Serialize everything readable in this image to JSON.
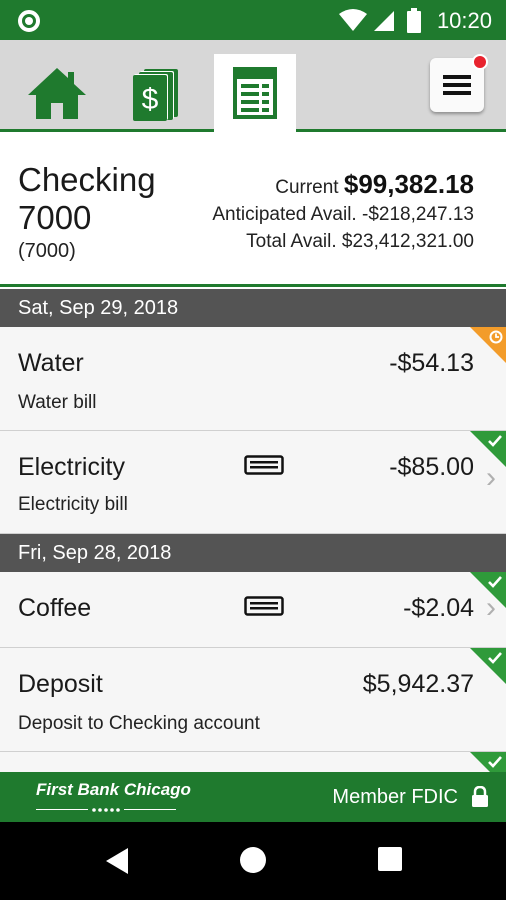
{
  "status_bar": {
    "time": "10:20",
    "icons": [
      "circle-icon",
      "wifi-icon",
      "signal-icon",
      "battery-icon"
    ]
  },
  "tabs": [
    {
      "name": "home",
      "icon": "home-icon",
      "active": false
    },
    {
      "name": "accounts",
      "icon": "money-icon",
      "active": false
    },
    {
      "name": "register",
      "icon": "register-icon",
      "active": true
    }
  ],
  "menu": {
    "icon": "menu-icon",
    "has_notification": true
  },
  "account": {
    "name": "Checking 7000",
    "number": "(7000)",
    "current_label": "Current",
    "current_value": "$99,382.18",
    "anticipated_label": "Anticipated Avail.",
    "anticipated_value": "-$218,247.13",
    "total_label": "Total Avail.",
    "total_value": "$23,412,321.00"
  },
  "groups": [
    {
      "date": "Sat, Sep 29, 2018",
      "transactions": [
        {
          "title": "Water",
          "description": "Water bill",
          "amount": "-$54.13",
          "status": "pending",
          "has_card": false,
          "has_chevron": false
        },
        {
          "title": "Electricity",
          "description": "Electricity bill",
          "amount": "-$85.00",
          "status": "cleared",
          "has_card": true,
          "has_chevron": true
        }
      ]
    },
    {
      "date": "Fri, Sep 28, 2018",
      "transactions": [
        {
          "title": "Coffee",
          "description": "",
          "amount": "-$2.04",
          "status": "cleared",
          "has_card": true,
          "has_chevron": true
        },
        {
          "title": "Deposit",
          "description": "Deposit to Checking account",
          "amount": "$5,942.37",
          "status": "cleared",
          "has_card": false,
          "has_chevron": false
        }
      ]
    }
  ],
  "footer": {
    "brand": "First Bank Chicago",
    "member": "Member FDIC"
  },
  "colors": {
    "brand_green": "#1f7a2e",
    "header_gray": "#545454",
    "pending_orange": "#f39c2a",
    "cleared_green": "#2f9a3a",
    "notification_red": "#e8232e"
  }
}
